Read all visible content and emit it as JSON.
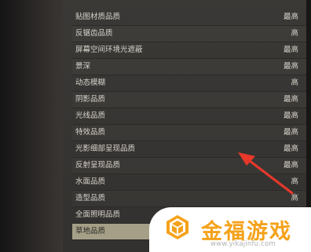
{
  "settings": {
    "rows": [
      {
        "label": "贴图材质品质",
        "value": "最高"
      },
      {
        "label": "反锯齿品质",
        "value": "高"
      },
      {
        "label": "屏幕空间环境光遮蔽",
        "value": "最高"
      },
      {
        "label": "景深",
        "value": "最高"
      },
      {
        "label": "动态模糊",
        "value": "高"
      },
      {
        "label": "阴影品质",
        "value": "最高"
      },
      {
        "label": "光线品质",
        "value": "最高"
      },
      {
        "label": "特效品质",
        "value": "最高"
      },
      {
        "label": "光影细部呈现品质",
        "value": "最高"
      },
      {
        "label": "反射呈现品质",
        "value": "最高"
      },
      {
        "label": "水面品质",
        "value": "高"
      },
      {
        "label": "造型品质",
        "value": "高"
      },
      {
        "label": "全面照明品质",
        "value": ""
      },
      {
        "label": "草地品质",
        "value": ""
      }
    ]
  },
  "watermark": {
    "brand": "金福游戏",
    "url": "www.yikajinfu.com"
  },
  "colors": {
    "accent": "#f5a21a",
    "arrow": "#e8382a",
    "selected_row": "#a59f88"
  }
}
